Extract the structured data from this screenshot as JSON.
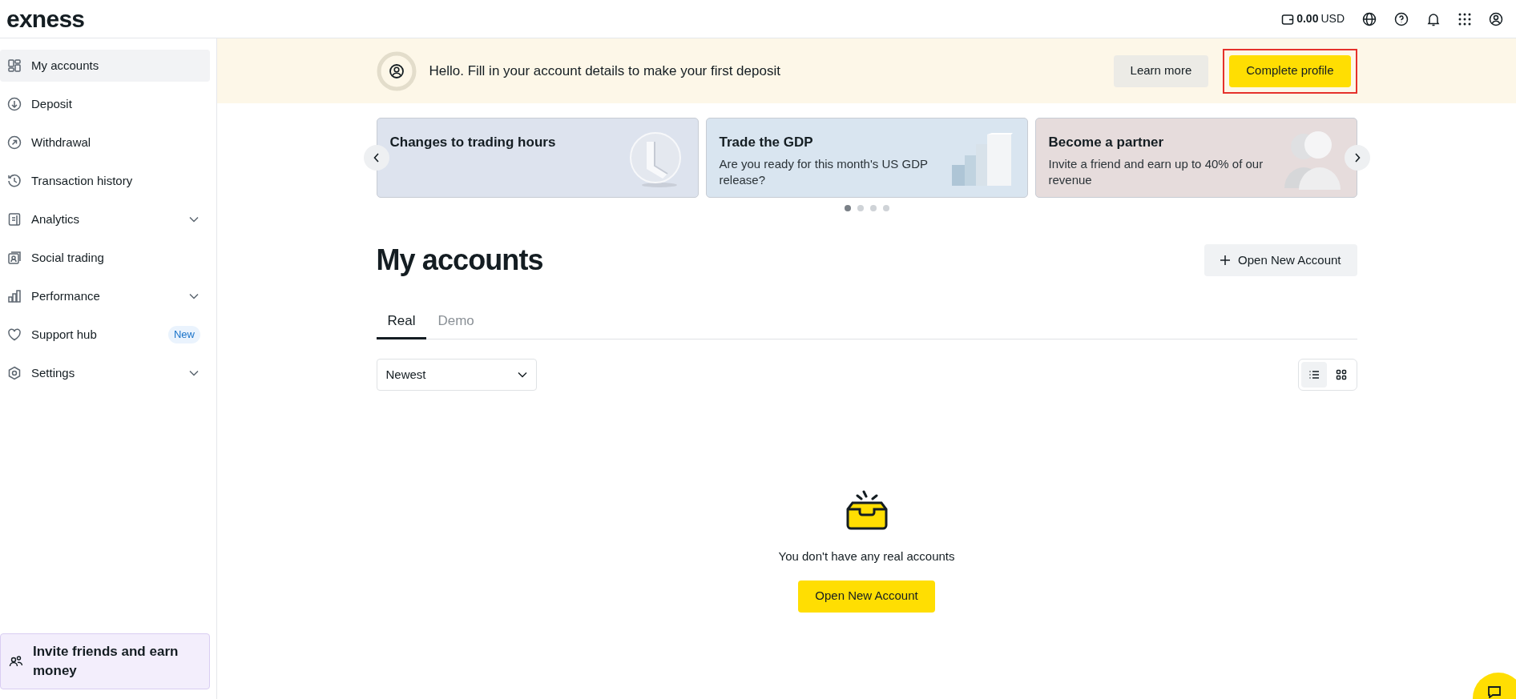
{
  "header": {
    "logo": "exness",
    "balance": "0.00",
    "currency": "USD"
  },
  "sidebar": {
    "items": [
      {
        "label": "My accounts",
        "kind": "grid",
        "selected": true
      },
      {
        "label": "Deposit",
        "kind": "down",
        "selected": false
      },
      {
        "label": "Withdrawal",
        "kind": "up",
        "selected": false
      },
      {
        "label": "Transaction history",
        "kind": "history",
        "selected": false
      },
      {
        "label": "Analytics",
        "kind": "doc",
        "selected": false,
        "expandable": true
      },
      {
        "label": "Social trading",
        "kind": "social",
        "selected": false
      },
      {
        "label": "Performance",
        "kind": "bars",
        "selected": false,
        "expandable": true
      },
      {
        "label": "Support hub",
        "kind": "heart",
        "selected": false,
        "badge": "New"
      },
      {
        "label": "Settings",
        "kind": "gear",
        "selected": false,
        "expandable": true
      }
    ],
    "invite": "Invite friends and earn money"
  },
  "notice": {
    "text": "Hello. Fill in your account details to make your first deposit",
    "buttons": [
      {
        "label": "Learn more",
        "kind": "secondary",
        "highlighted": false
      },
      {
        "label": "Complete profile",
        "kind": "primary",
        "highlighted": true
      }
    ]
  },
  "promos": [
    {
      "title": "Changes to trading hours",
      "kind": "clock"
    },
    {
      "title": "Trade the GDP",
      "text": "Are you ready for this month's US GDP release?",
      "kind": "stairs"
    },
    {
      "title": "Become a partner",
      "text": "Invite a friend and earn up to 40% of our revenue",
      "kind": "people"
    }
  ],
  "carousel_dots": [
    {
      "selected": true
    },
    {
      "selected": false
    },
    {
      "selected": false
    },
    {
      "selected": false
    }
  ],
  "page_title": "My accounts",
  "open_account_button": "Open New Account",
  "tabs": [
    {
      "label": "Real",
      "selected": true
    },
    {
      "label": "Demo",
      "selected": false
    }
  ],
  "sort": {
    "value": "Newest"
  },
  "views": [
    {
      "kind": "list",
      "selected": true
    },
    {
      "kind": "grid",
      "selected": false
    }
  ],
  "empty": {
    "text": "You don't have any real accounts",
    "button": "Open New Account"
  }
}
